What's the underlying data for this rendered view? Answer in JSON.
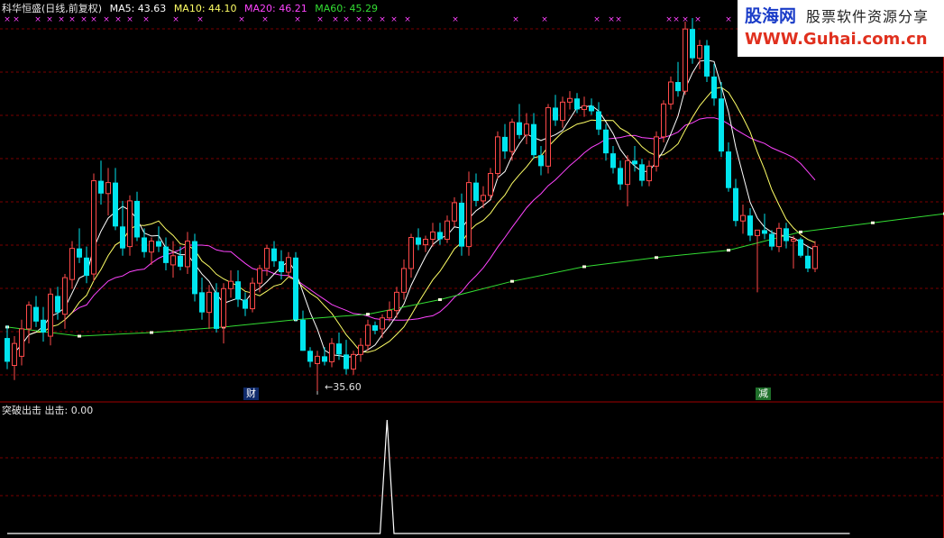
{
  "header": {
    "title": "科华恒盛(日线,前复权)",
    "ma5": "MA5: 43.63",
    "ma10": "MA10: 44.10",
    "ma20": "MA20: 46.21",
    "ma60": "MA60: 45.29"
  },
  "colors": {
    "background": "#000000",
    "up": "#ff4a4a",
    "down": "#00e5ee",
    "ma5": "#ffffff",
    "ma10": "#ffff66",
    "ma20": "#ff44ff",
    "ma60": "#33dd33",
    "grid": "#7a0000",
    "marker": "#ff44ff"
  },
  "annotations": {
    "low_label": "←35.60",
    "badge_cai": "财",
    "badge_jian": "减"
  },
  "indicator": {
    "title": "突破出击",
    "label": "出击: 0.00"
  },
  "logo": {
    "name": "股海网",
    "slogan": "股票软件资源分享",
    "url": "WWW.Guhai.com.cn"
  },
  "chart_data": [
    {
      "type": "candlestick",
      "title": "科华恒盛(日线,前复权)",
      "candles": [
        [
          38.5,
          39.2,
          36.8,
          37.2
        ],
        [
          37.0,
          38.6,
          36.2,
          38.2
        ],
        [
          37.5,
          39.5,
          37.0,
          39.0
        ],
        [
          39.0,
          40.5,
          38.2,
          40.3
        ],
        [
          40.2,
          40.8,
          39.1,
          39.4
        ],
        [
          39.5,
          40.2,
          38.3,
          38.8
        ],
        [
          38.6,
          41.2,
          38.1,
          40.9
        ],
        [
          40.8,
          41.3,
          39.5,
          39.9
        ],
        [
          39.8,
          42.0,
          39.0,
          41.8
        ],
        [
          41.7,
          43.8,
          41.2,
          43.4
        ],
        [
          43.4,
          44.5,
          42.6,
          42.9
        ],
        [
          42.9,
          43.5,
          41.5,
          41.9
        ],
        [
          42.0,
          47.5,
          41.6,
          47.1
        ],
        [
          47.1,
          48.2,
          45.8,
          46.4
        ],
        [
          46.4,
          47.8,
          45.2,
          47.0
        ],
        [
          47.0,
          47.8,
          44.4,
          44.6
        ],
        [
          44.6,
          46.0,
          43.0,
          43.4
        ],
        [
          43.5,
          46.3,
          43.0,
          46.0
        ],
        [
          46.0,
          46.5,
          43.8,
          44.0
        ],
        [
          44.0,
          44.5,
          42.9,
          43.2
        ],
        [
          43.2,
          44.0,
          42.5,
          43.8
        ],
        [
          43.8,
          44.6,
          43.2,
          43.5
        ],
        [
          43.5,
          44.0,
          42.2,
          42.6
        ],
        [
          42.5,
          43.8,
          41.8,
          43.0
        ],
        [
          43.0,
          43.5,
          42.2,
          42.4
        ],
        [
          42.4,
          44.3,
          42.0,
          43.8
        ],
        [
          43.8,
          44.2,
          40.5,
          40.9
        ],
        [
          41.0,
          41.8,
          39.5,
          39.9
        ],
        [
          39.9,
          41.4,
          39.0,
          41.0
        ],
        [
          41.0,
          41.5,
          38.8,
          39.0
        ],
        [
          39.1,
          41.5,
          38.2,
          41.2
        ],
        [
          41.2,
          42.2,
          40.7,
          41.6
        ],
        [
          41.6,
          42.2,
          40.2,
          40.6
        ],
        [
          40.6,
          41.0,
          39.7,
          40.1
        ],
        [
          40.1,
          41.8,
          39.9,
          41.5
        ],
        [
          41.5,
          42.5,
          41.0,
          42.3
        ],
        [
          42.3,
          43.6,
          41.9,
          43.4
        ],
        [
          43.4,
          43.8,
          42.4,
          42.7
        ],
        [
          42.7,
          43.3,
          41.7,
          42.1
        ],
        [
          42.1,
          43.2,
          41.8,
          42.9
        ],
        [
          42.9,
          43.2,
          39.4,
          39.5
        ],
        [
          39.5,
          40.0,
          37.8,
          37.8
        ],
        [
          37.8,
          38.0,
          36.9,
          37.2
        ],
        [
          37.1,
          37.8,
          35.6,
          37.5
        ],
        [
          37.5,
          38.0,
          37.0,
          37.2
        ],
        [
          37.2,
          38.5,
          36.9,
          38.2
        ],
        [
          38.2,
          38.8,
          37.3,
          37.6
        ],
        [
          37.6,
          38.4,
          36.5,
          36.8
        ],
        [
          36.8,
          37.8,
          36.5,
          37.6
        ],
        [
          37.6,
          38.5,
          37.2,
          38.1
        ],
        [
          38.1,
          39.5,
          37.8,
          39.2
        ],
        [
          39.2,
          39.4,
          38.7,
          38.9
        ],
        [
          39.0,
          39.8,
          38.5,
          39.6
        ],
        [
          39.6,
          40.5,
          39.4,
          40.0
        ],
        [
          40.0,
          41.3,
          39.6,
          41.0
        ],
        [
          41.0,
          42.8,
          40.6,
          42.3
        ],
        [
          42.3,
          44.2,
          41.8,
          44.0
        ],
        [
          44.0,
          44.5,
          43.3,
          43.6
        ],
        [
          43.6,
          44.1,
          43.2,
          43.9
        ],
        [
          43.9,
          44.8,
          43.5,
          44.3
        ],
        [
          44.3,
          44.8,
          43.6,
          43.9
        ],
        [
          43.9,
          45.2,
          43.7,
          44.9
        ],
        [
          44.9,
          46.2,
          44.6,
          45.9
        ],
        [
          45.9,
          46.4,
          43.0,
          43.5
        ],
        [
          43.5,
          47.6,
          43.0,
          47.0
        ],
        [
          47.0,
          47.5,
          45.7,
          46.0
        ],
        [
          46.0,
          46.8,
          45.6,
          46.3
        ],
        [
          46.3,
          47.8,
          46.1,
          47.5
        ],
        [
          47.5,
          49.8,
          47.2,
          49.5
        ],
        [
          49.5,
          50.2,
          48.3,
          48.7
        ],
        [
          48.7,
          50.5,
          48.2,
          50.3
        ],
        [
          50.3,
          51.3,
          49.4,
          49.6
        ],
        [
          49.6,
          50.8,
          49.1,
          50.2
        ],
        [
          50.2,
          50.8,
          48.3,
          48.5
        ],
        [
          48.5,
          49.0,
          47.4,
          47.9
        ],
        [
          47.9,
          51.3,
          47.5,
          51.1
        ],
        [
          51.1,
          51.8,
          50.1,
          50.4
        ],
        [
          50.4,
          51.7,
          50.0,
          51.4
        ],
        [
          51.4,
          52.0,
          51.0,
          51.6
        ],
        [
          51.6,
          51.9,
          50.8,
          51.0
        ],
        [
          51.0,
          51.7,
          50.6,
          51.2
        ],
        [
          51.2,
          51.6,
          50.7,
          50.9
        ],
        [
          50.9,
          51.4,
          49.6,
          49.9
        ],
        [
          49.9,
          50.2,
          48.2,
          48.6
        ],
        [
          48.6,
          49.0,
          47.5,
          47.8
        ],
        [
          47.8,
          48.2,
          46.6,
          46.9
        ],
        [
          46.9,
          48.5,
          45.7,
          48.2
        ],
        [
          48.2,
          49.0,
          47.6,
          48.0
        ],
        [
          48.0,
          48.3,
          46.8,
          47.1
        ],
        [
          47.1,
          48.2,
          46.8,
          47.9
        ],
        [
          47.9,
          49.8,
          47.6,
          49.5
        ],
        [
          49.5,
          51.5,
          49.2,
          51.3
        ],
        [
          51.3,
          52.8,
          51.0,
          52.5
        ],
        [
          52.5,
          53.6,
          51.7,
          52.0
        ],
        [
          52.0,
          55.8,
          51.8,
          55.4
        ],
        [
          55.4,
          56.0,
          53.5,
          53.8
        ],
        [
          53.8,
          54.8,
          53.2,
          54.5
        ],
        [
          54.5,
          54.8,
          52.5,
          52.8
        ],
        [
          52.8,
          53.5,
          51.2,
          51.6
        ],
        [
          51.6,
          52.5,
          48.4,
          48.7
        ],
        [
          48.7,
          49.2,
          46.5,
          46.7
        ],
        [
          46.7,
          47.2,
          44.6,
          44.9
        ],
        [
          44.9,
          45.8,
          44.2,
          45.2
        ],
        [
          45.2,
          45.6,
          43.8,
          44.1
        ],
        [
          44.1,
          44.4,
          41.0,
          44.4
        ],
        [
          44.4,
          45.3,
          43.9,
          44.2
        ],
        [
          44.2,
          44.4,
          43.3,
          43.5
        ],
        [
          43.5,
          44.8,
          43.2,
          44.5
        ],
        [
          44.5,
          44.8,
          43.4,
          43.8
        ],
        [
          43.8,
          44.1,
          42.3,
          43.9
        ],
        [
          43.9,
          44.0,
          42.9,
          43.0
        ],
        [
          43.0,
          43.5,
          42.1,
          42.3
        ],
        [
          42.3,
          43.8,
          42.1,
          43.5
        ]
      ],
      "ma60_markers": [
        [
          0,
          39.1
        ],
        [
          10,
          38.6
        ],
        [
          20,
          38.8
        ],
        [
          30,
          39.1
        ],
        [
          40,
          39.5
        ],
        [
          50,
          39.8
        ],
        [
          60,
          40.6
        ],
        [
          70,
          41.6
        ],
        [
          80,
          42.4
        ],
        [
          90,
          42.9
        ],
        [
          100,
          43.3
        ],
        [
          110,
          44.3
        ],
        [
          120,
          44.8
        ],
        [
          130,
          45.3
        ]
      ],
      "ylim": [
        35.3,
        56.0
      ],
      "low_mark": {
        "value": 35.6
      }
    },
    {
      "type": "line",
      "title": "突破出击",
      "series": [
        {
          "name": "出击",
          "values": [
            0,
            0,
            0,
            0,
            0,
            0,
            0,
            0,
            0,
            0,
            0,
            0,
            0,
            0,
            0,
            0,
            0,
            0,
            0,
            0,
            0,
            0,
            0,
            0,
            0,
            0,
            0,
            0,
            0,
            0,
            0,
            0,
            0,
            0,
            0,
            0,
            0,
            0,
            0,
            0,
            0,
            0,
            0,
            0,
            0,
            0,
            0,
            0,
            0,
            0,
            0,
            0,
            0,
            0,
            0,
            1,
            0,
            0,
            0,
            0,
            0,
            0,
            0,
            0,
            0,
            0,
            0,
            0,
            0,
            0,
            0,
            0,
            0,
            0,
            0,
            0,
            0,
            0,
            0,
            0,
            0,
            0,
            0,
            0,
            0,
            0,
            0,
            0,
            0,
            0,
            0,
            0,
            0,
            0,
            0,
            0,
            0,
            0,
            0,
            0,
            0,
            0,
            0,
            0,
            0,
            0,
            0,
            0,
            0,
            0,
            0,
            0,
            0,
            0,
            0,
            0,
            0,
            0,
            0,
            0,
            0,
            0,
            0,
            0,
            0,
            0,
            0,
            0,
            0,
            0,
            0,
            0,
            0,
            0
          ]
        }
      ],
      "ylim": [
        0,
        1
      ]
    }
  ]
}
